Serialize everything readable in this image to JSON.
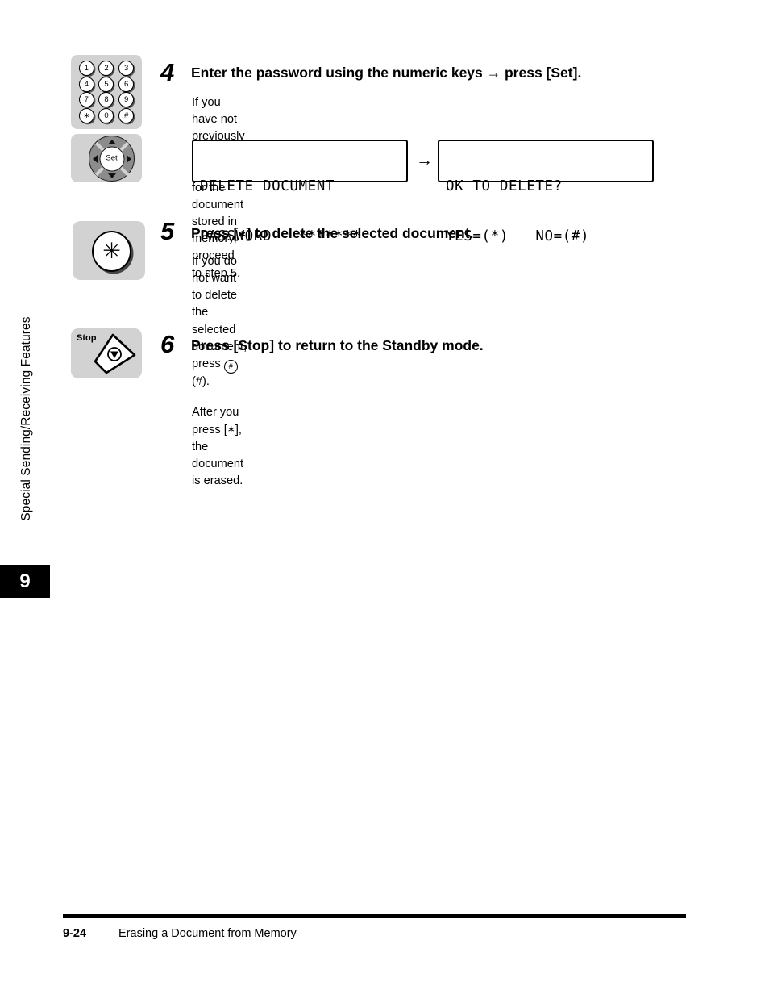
{
  "sidebar": {
    "section_label": "Special Sending/Receiving Features",
    "chapter_number": "9"
  },
  "steps": [
    {
      "number": "4",
      "title": "Enter the password using the numeric keys → press [Set].",
      "body_line1": "If you have not previously set a password for the document stored in memory,",
      "body_line2": "proceed to step 5.",
      "icons": {
        "keypad": {
          "name": "numeric-keypad-icon",
          "keys": [
            "1",
            "2",
            "3",
            "4",
            "5",
            "6",
            "7",
            "8",
            "9",
            "∗",
            "0",
            "#"
          ]
        },
        "set_dial": {
          "name": "set-dial-icon",
          "center_label": "Set"
        }
      },
      "lcd_first": {
        "line1": "DELETE DOCUMENT",
        "line2": "PASSWORD   *******"
      },
      "lcd_arrow": "→",
      "lcd_second": {
        "line1": "OK TO DELETE?",
        "line2": "YES=(*)   NO=(#)"
      }
    },
    {
      "number": "5",
      "title_prefix": "Press [",
      "title_key": "∗",
      "title_suffix": "] to delete the selected document.",
      "body_line1_prefix": "If you do not want to delete the selected document, press ",
      "body_line1_key": "#",
      "body_line1_suffix": "(#).",
      "body_line2_prefix": "After you press [",
      "body_line2_key": "∗",
      "body_line2_suffix": "], the document is erased.",
      "icons": {
        "asterisk_key": {
          "name": "asterisk-key-icon",
          "glyph": "✳"
        }
      }
    },
    {
      "number": "6",
      "title": "Press [Stop] to return to the Standby mode.",
      "icons": {
        "stop_key": {
          "name": "stop-key-icon",
          "label": "Stop"
        }
      }
    }
  ],
  "footer": {
    "page_number": "9-24",
    "section_title": "Erasing a Document from Memory"
  }
}
